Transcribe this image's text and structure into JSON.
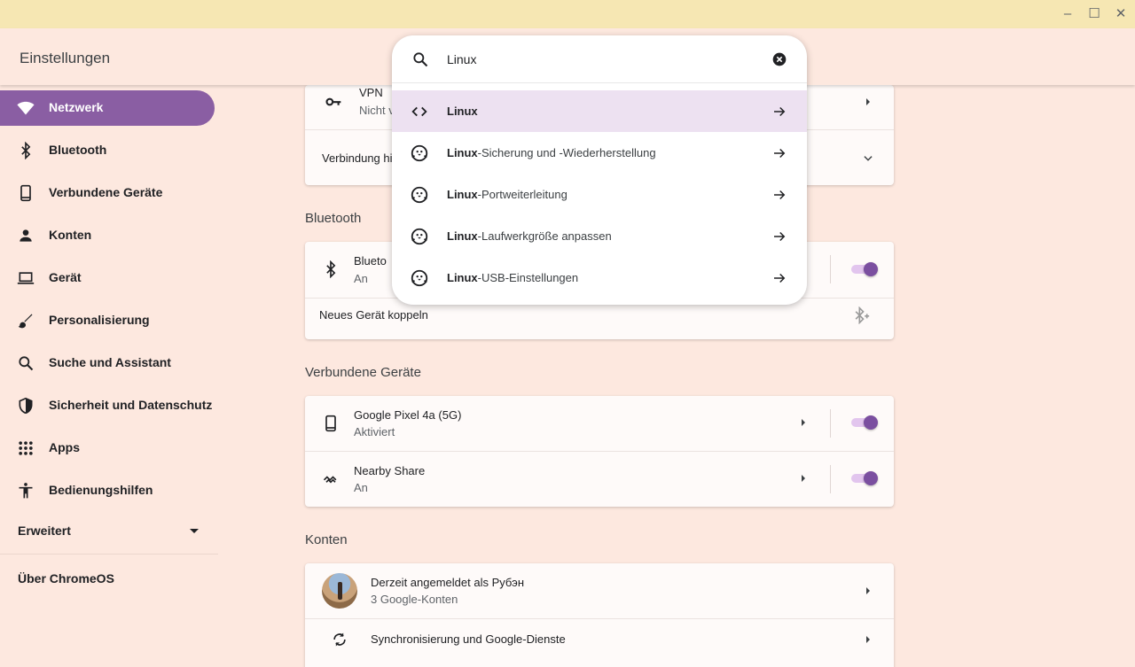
{
  "app": {
    "title": "Einstellungen"
  },
  "window_controls": {
    "minimize": "–",
    "maximize": "☐",
    "close": "✕"
  },
  "sidebar": {
    "items": [
      {
        "label": "Netzwerk",
        "icon": "wifi-icon",
        "active": true
      },
      {
        "label": "Bluetooth",
        "icon": "bluetooth-icon"
      },
      {
        "label": "Verbundene Geräte",
        "icon": "phone-icon"
      },
      {
        "label": "Konten",
        "icon": "person-icon"
      },
      {
        "label": "Gerät",
        "icon": "laptop-icon"
      },
      {
        "label": "Personalisierung",
        "icon": "brush-icon"
      },
      {
        "label": "Suche und Assistant",
        "icon": "search-icon"
      },
      {
        "label": "Sicherheit und Datenschutz",
        "icon": "shield-icon"
      },
      {
        "label": "Apps",
        "icon": "apps-grid-icon"
      },
      {
        "label": "Bedienungshilfen",
        "icon": "accessibility-icon"
      }
    ],
    "advanced_label": "Erweitert",
    "about_label": "Über ChromeOS"
  },
  "main": {
    "network_card": {
      "vpn_title": "VPN",
      "vpn_subtitle": "Nicht v",
      "add_connection_label": "Verbindung hi"
    },
    "bluetooth": {
      "section_title": "Bluetooth",
      "toggle_title": "Blueto",
      "toggle_status": "An",
      "toggle_on": true,
      "pair_label": "Neues Gerät koppeln"
    },
    "connected_devices": {
      "section_title": "Verbundene Geräte",
      "rows": [
        {
          "title": "Google Pixel 4a (5G)",
          "subtitle": "Aktiviert",
          "icon": "phone-icon",
          "on": true
        },
        {
          "title": "Nearby Share",
          "subtitle": "An",
          "icon": "nearby-share-icon",
          "on": true
        }
      ]
    },
    "accounts": {
      "section_title": "Konten",
      "signed_in": "Derzeit angemeldet als Рубэн",
      "accounts_count": "3 Google-Konten",
      "sync_label": "Synchronisierung und Google-Dienste"
    }
  },
  "search": {
    "query": "Linux",
    "results": [
      {
        "bold": "Linux",
        "rest": "",
        "icon": "code-icon",
        "selected": true
      },
      {
        "bold": "Linux",
        "rest": "-Sicherung und -Wiederherstellung",
        "icon": "linux-penguin-icon"
      },
      {
        "bold": "Linux",
        "rest": "-Portweiterleitung",
        "icon": "linux-penguin-icon"
      },
      {
        "bold": "Linux",
        "rest": "-Laufwerkgröße anpassen",
        "icon": "linux-penguin-icon"
      },
      {
        "bold": "Linux",
        "rest": "-USB-Einstellungen",
        "icon": "linux-penguin-icon"
      }
    ]
  },
  "colors": {
    "accent": "#8a5ea3",
    "background": "#fde8df",
    "titlebar": "#f6e7b3"
  }
}
